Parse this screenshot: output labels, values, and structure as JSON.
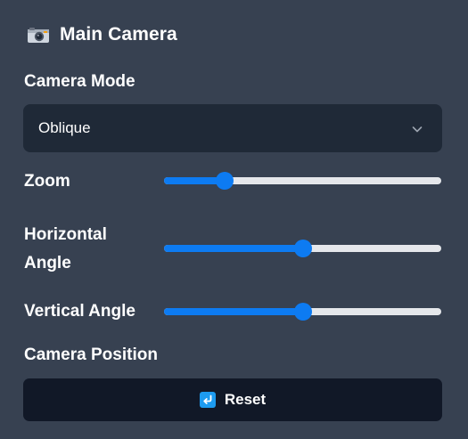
{
  "panel": {
    "title": "Main Camera",
    "title_icon": "camera-icon"
  },
  "camera_mode": {
    "label": "Camera Mode",
    "selected": "Oblique",
    "icon": "chevron-down-icon"
  },
  "sliders": {
    "zoom": {
      "label": "Zoom",
      "value_fraction": 0.22
    },
    "horizontal_angle": {
      "label_line1": "Horizontal",
      "label_line2": "Angle",
      "value_fraction": 0.5
    },
    "vertical_angle": {
      "label": "Vertical Angle",
      "value_fraction": 0.5
    }
  },
  "camera_position": {
    "label": "Camera Position",
    "reset_label": "Reset",
    "reset_icon": "return-arrow-icon"
  },
  "colors": {
    "background": "#374151",
    "select_bg": "#1f2937",
    "button_bg": "#111827",
    "accent": "#0d7bf2",
    "track": "#e5e7eb"
  }
}
